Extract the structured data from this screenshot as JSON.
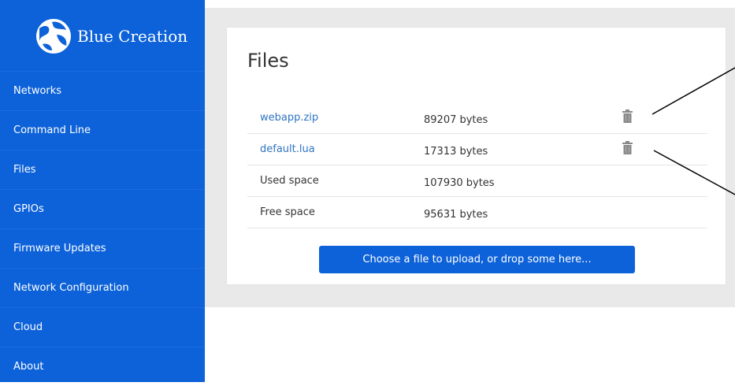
{
  "brand": {
    "name": "Blue Creation",
    "logo_icon": "globe-logo"
  },
  "sidebar": {
    "items": [
      {
        "label": "Networks"
      },
      {
        "label": "Command Line"
      },
      {
        "label": "Files"
      },
      {
        "label": "GPIOs"
      },
      {
        "label": "Firmware Updates"
      },
      {
        "label": "Network Configuration"
      },
      {
        "label": "Cloud"
      },
      {
        "label": "About"
      }
    ]
  },
  "main": {
    "title": "Files",
    "files": [
      {
        "name": "webapp.zip",
        "size": "89207 bytes",
        "action_icon": "trash-icon"
      },
      {
        "name": "default.lua",
        "size": "17313 bytes",
        "action_icon": "trash-icon"
      }
    ],
    "summary": [
      {
        "label": "Used space",
        "value": "107930 bytes"
      },
      {
        "label": "Free space",
        "value": "95631 bytes"
      }
    ],
    "upload_label": "Choose a file to upload, or drop some here..."
  },
  "colors": {
    "primary": "#0d62d9",
    "link": "#2f74c4",
    "background": "#e9e9e9"
  }
}
